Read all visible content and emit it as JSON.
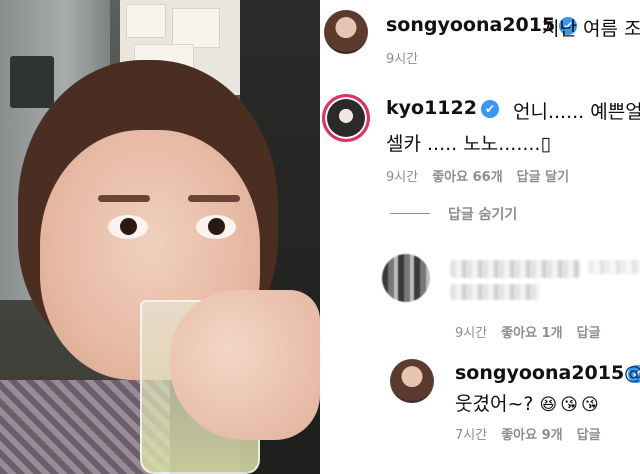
{
  "comments": {
    "post_author": {
      "username": "songyoona2015",
      "text": "지난 여름 조",
      "time": "9시간",
      "verified_icon": "✔"
    },
    "reply_1": {
      "username": "kyo1122",
      "verified_icon": "✔",
      "line1": "언니...... 예쁜얼굴 ..",
      "line2": "셀카 ..... 노노.......▯",
      "time": "9시간",
      "likes": "좋아요 66개",
      "reply_action": "답글 달기"
    },
    "hide_replies": "답글 숨기기",
    "reply_2": {
      "time": "9시간",
      "likes": "좋아요 1개",
      "reply_action": "답글"
    },
    "reply_3": {
      "username": "songyoona2015",
      "verified_icon": "✔",
      "mention_start": "@",
      "text": "웃겼어~?",
      "emojis": [
        "😆",
        "😘",
        "😘"
      ],
      "time": "7시간",
      "likes": "좋아요 9개",
      "reply_action": "답글"
    }
  },
  "colors": {
    "verified": "#3897f0",
    "meta_text": "#8e8e8e",
    "story_ring": "#e1306c"
  }
}
